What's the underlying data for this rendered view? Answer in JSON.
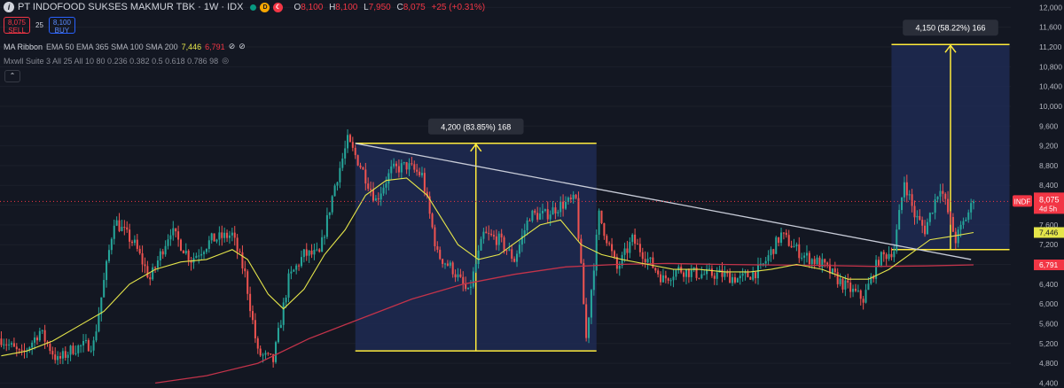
{
  "header": {
    "title": "PT INDOFOOD SUKSES MAKMUR TBK · 1W · IDX",
    "badge_d": "D",
    "ohlc": [
      {
        "k": "O",
        "v": "8,100"
      },
      {
        "k": "H",
        "v": "8,100"
      },
      {
        "k": "L",
        "v": "7,950"
      },
      {
        "k": "C",
        "v": "8,075"
      }
    ],
    "change": "+25 (+0.31%)"
  },
  "trade": {
    "sell_price": "8,075",
    "sell_label": "SELL",
    "spread": "25",
    "buy_price": "8,100",
    "buy_label": "BUY"
  },
  "indicators": {
    "ma_name": "MA Ribbon",
    "ma_params": "EMA 50 EMA 365 SMA 100 SMA 200",
    "ma_v1": "7,446",
    "ma_v2": "6,791",
    "fib_name": "Mxwll Suite 3 All 25 All 10 80 0.236 0.382 0.5 0.618 0.786 98"
  },
  "colors": {
    "background": "#131722",
    "up": "#26a69a",
    "down": "#ef5350",
    "ma_fast": "#e5e54a",
    "ma_slow": "#c2334a",
    "measure": "#ffeb3b",
    "measure_fill": "#1e2a52",
    "trendline": "#c8ccd8",
    "last_price": "#f23645"
  },
  "chart_data": {
    "type": "candlestick",
    "symbol": "INDF",
    "ylim": [
      4300,
      12150
    ],
    "y_ticks": [
      "12,000",
      "11,600",
      "11,200",
      "10,800",
      "10,400",
      "10,000",
      "9,600",
      "9,200",
      "8,800",
      "8,400",
      "8,000",
      "7,600",
      "7,200",
      "6,800",
      "6,400",
      "6,000",
      "5,600",
      "5,200",
      "4,800",
      "4,400"
    ],
    "candle_count": 380,
    "last_candle_label": {
      "symbol": "INDF",
      "price": "8,075",
      "countdown": "4d 5h"
    },
    "ma_fast_label": "7,446",
    "ma_slow_label": "6,791",
    "price_path": [
      [
        0,
        5300
      ],
      [
        8,
        4950
      ],
      [
        15,
        5450
      ],
      [
        22,
        4850
      ],
      [
        28,
        5100
      ],
      [
        36,
        5200
      ],
      [
        44,
        7700
      ],
      [
        52,
        7200
      ],
      [
        58,
        6500
      ],
      [
        66,
        7500
      ],
      [
        74,
        6900
      ],
      [
        82,
        7300
      ],
      [
        90,
        7400
      ],
      [
        95,
        6600
      ],
      [
        100,
        5000
      ],
      [
        106,
        4850
      ],
      [
        112,
        6500
      ],
      [
        118,
        7000
      ],
      [
        124,
        7000
      ],
      [
        130,
        8400
      ],
      [
        135,
        9300
      ],
      [
        140,
        8800
      ],
      [
        146,
        8100
      ],
      [
        152,
        8700
      ],
      [
        158,
        8800
      ],
      [
        164,
        8600
      ],
      [
        170,
        7000
      ],
      [
        176,
        6700
      ],
      [
        182,
        6200
      ],
      [
        188,
        7400
      ],
      [
        194,
        7300
      ],
      [
        200,
        6900
      ],
      [
        206,
        7800
      ],
      [
        212,
        7800
      ],
      [
        218,
        8000
      ],
      [
        224,
        8100
      ],
      [
        228,
        5300
      ],
      [
        233,
        7800
      ],
      [
        240,
        6700
      ],
      [
        246,
        7300
      ],
      [
        252,
        6900
      ],
      [
        258,
        6500
      ],
      [
        264,
        6700
      ],
      [
        272,
        6600
      ],
      [
        280,
        6600
      ],
      [
        288,
        6500
      ],
      [
        296,
        6700
      ],
      [
        304,
        7400
      ],
      [
        312,
        7000
      ],
      [
        320,
        6800
      ],
      [
        328,
        6400
      ],
      [
        336,
        6100
      ],
      [
        342,
        6900
      ],
      [
        348,
        7100
      ],
      [
        352,
        8500
      ],
      [
        356,
        7800
      ],
      [
        360,
        7500
      ],
      [
        366,
        8400
      ],
      [
        372,
        7300
      ],
      [
        379,
        8075
      ]
    ],
    "ma_fast": [
      [
        0,
        4950
      ],
      [
        10,
        5050
      ],
      [
        20,
        5250
      ],
      [
        30,
        5550
      ],
      [
        40,
        5850
      ],
      [
        50,
        6400
      ],
      [
        60,
        6700
      ],
      [
        70,
        6850
      ],
      [
        80,
        6900
      ],
      [
        90,
        7100
      ],
      [
        96,
        6900
      ],
      [
        104,
        6200
      ],
      [
        110,
        5900
      ],
      [
        118,
        6300
      ],
      [
        126,
        7000
      ],
      [
        134,
        7500
      ],
      [
        142,
        8200
      ],
      [
        150,
        8500
      ],
      [
        158,
        8550
      ],
      [
        166,
        8200
      ],
      [
        172,
        7700
      ],
      [
        178,
        7200
      ],
      [
        186,
        6900
      ],
      [
        194,
        7000
      ],
      [
        202,
        7300
      ],
      [
        210,
        7600
      ],
      [
        218,
        7700
      ],
      [
        226,
        7200
      ],
      [
        234,
        7000
      ],
      [
        242,
        6900
      ],
      [
        252,
        6800
      ],
      [
        262,
        6700
      ],
      [
        272,
        6700
      ],
      [
        282,
        6650
      ],
      [
        292,
        6650
      ],
      [
        300,
        6700
      ],
      [
        310,
        6800
      ],
      [
        320,
        6700
      ],
      [
        330,
        6500
      ],
      [
        338,
        6500
      ],
      [
        346,
        6700
      ],
      [
        354,
        7000
      ],
      [
        362,
        7300
      ],
      [
        372,
        7380
      ],
      [
        379,
        7446
      ]
    ],
    "ma_slow": [
      [
        60,
        4400
      ],
      [
        80,
        4550
      ],
      [
        100,
        4800
      ],
      [
        120,
        5300
      ],
      [
        140,
        5700
      ],
      [
        160,
        6100
      ],
      [
        180,
        6400
      ],
      [
        200,
        6600
      ],
      [
        220,
        6750
      ],
      [
        240,
        6800
      ],
      [
        260,
        6820
      ],
      [
        280,
        6800
      ],
      [
        300,
        6790
      ],
      [
        320,
        6780
      ],
      [
        340,
        6760
      ],
      [
        360,
        6770
      ],
      [
        379,
        6791
      ]
    ],
    "trendline": {
      "from": [
        138,
        9250
      ],
      "to": [
        378,
        6900
      ]
    },
    "measurements": [
      {
        "label": "4,200 (83.85%) 168",
        "from_candle": 138,
        "to_candle": 232,
        "low": 5050,
        "high": 9250
      },
      {
        "label": "4,150 (58.22%) 166",
        "from_candle": 347,
        "to_candle": 393,
        "low": 7100,
        "high": 11250
      }
    ]
  }
}
